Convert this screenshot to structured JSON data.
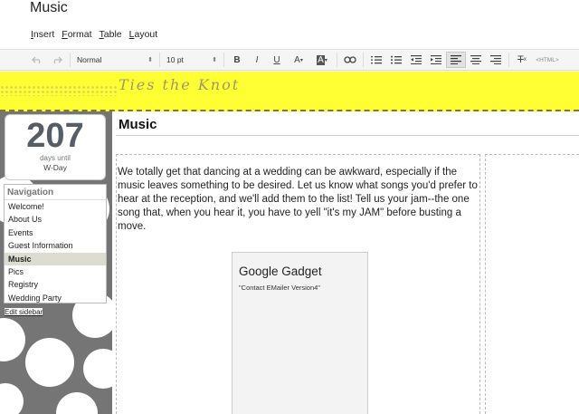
{
  "document": {
    "title": "Music"
  },
  "menu": {
    "items": [
      "Insert",
      "Format",
      "Table",
      "Layout"
    ]
  },
  "toolbar": {
    "style_select": "Normal",
    "size_select": "10 pt",
    "bold": "B",
    "italic": "I",
    "underline": "U",
    "font_color": "A",
    "highlight": "A",
    "html_label": "<HTML>",
    "clear_format": "T"
  },
  "banner": {
    "title": "Ties the Knot",
    "color": "#ffff33"
  },
  "sidebar": {
    "countdown": {
      "number": "207",
      "sub": "days until",
      "event": "W-Day"
    },
    "nav_heading": "Navigation",
    "nav_items": [
      {
        "label": "Welcome!",
        "active": false
      },
      {
        "label": "About Us",
        "active": false
      },
      {
        "label": "Events",
        "active": false
      },
      {
        "label": "Guest Information",
        "active": false
      },
      {
        "label": "Music",
        "active": true
      },
      {
        "label": "Pics",
        "active": false
      },
      {
        "label": "Registry",
        "active": false
      },
      {
        "label": "Wedding Party",
        "active": false
      }
    ],
    "edit_link": "Edit sidebar"
  },
  "main": {
    "title": "Music",
    "paragraph": "We totally get that dancing at a wedding can be awkward, especially if the music leaves something to be desired. Let us know what songs you'd prefer to hear at the reception, and we'll add them to the list! Tell us your jam--the one song that, when you hear it, you have to yell \"it's my JAM\" before busting a move.",
    "gadget": {
      "title": "Google Gadget",
      "subtitle": "\"Contact EMailer Version4\""
    }
  }
}
